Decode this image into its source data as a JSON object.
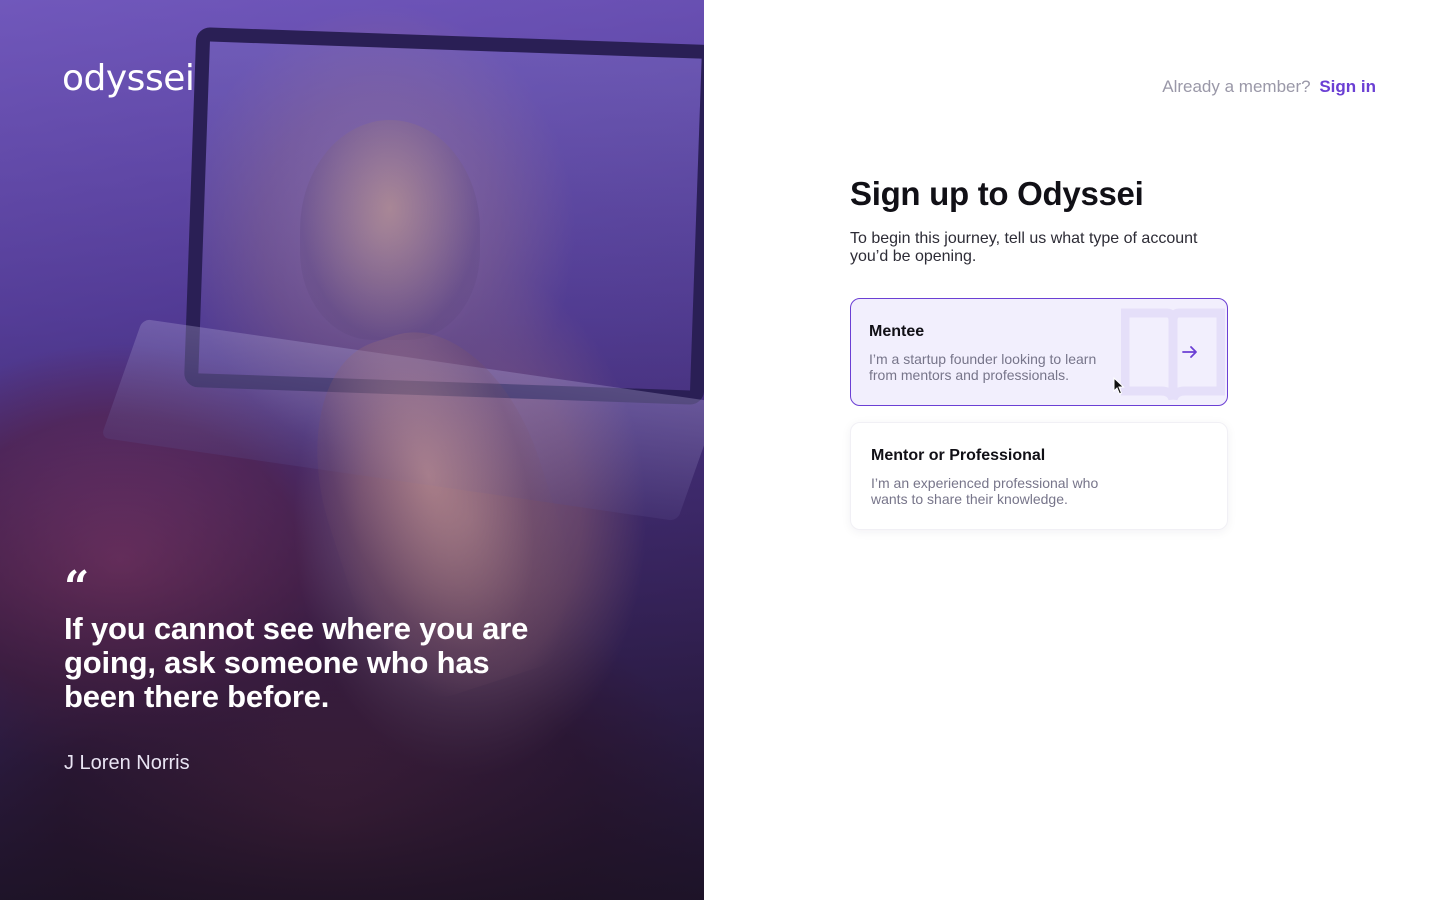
{
  "brand": {
    "logo": "odyssei"
  },
  "hero": {
    "quote_mark": "“",
    "quote": "If you cannot see where you are going, ask someone who has been there before.",
    "author": "J Loren Norris"
  },
  "header": {
    "prompt": "Already a member?",
    "signin_label": "Sign in"
  },
  "form": {
    "title": "Sign up to Odyssei",
    "subtitle": "To begin this journey, tell us what type of account you’d be opening.",
    "options": [
      {
        "title": "Mentee",
        "description": "I’m a startup founder looking to learn from mentors and professionals.",
        "selected": true,
        "icon": "arrow-right-icon"
      },
      {
        "title": "Mentor or Professional",
        "description": "I’m an experienced professional who wants to share their knowledge.",
        "selected": false
      }
    ]
  },
  "colors": {
    "accent": "#6b3fd4",
    "selected_card_bg": "#f2effd",
    "muted_text": "#9a98a8"
  }
}
